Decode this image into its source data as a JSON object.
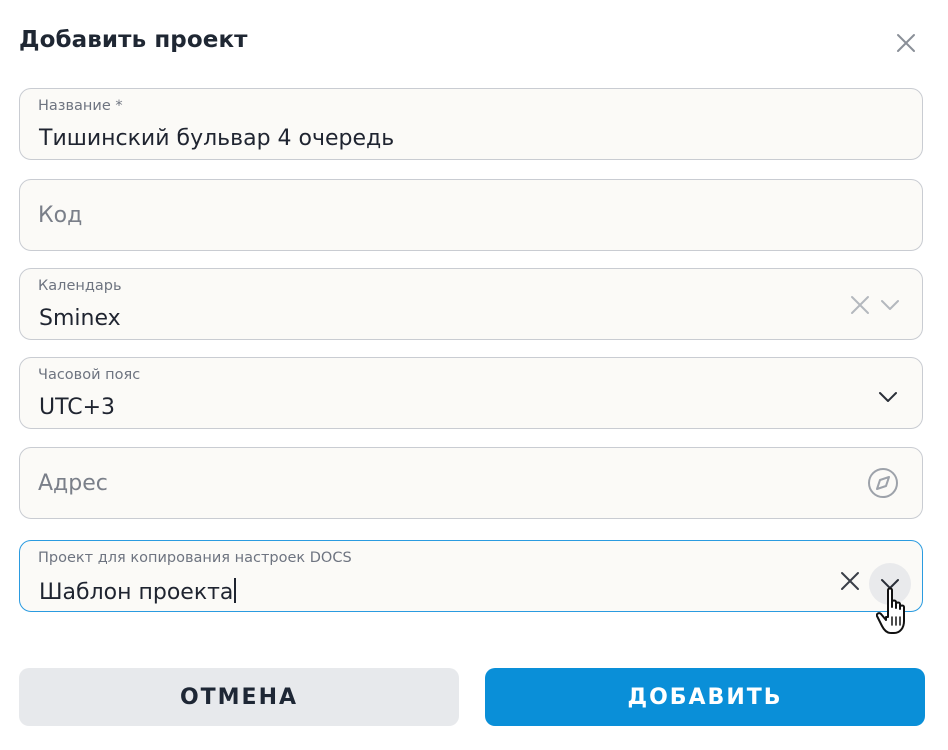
{
  "dialog": {
    "title": "Добавить проект"
  },
  "fields": {
    "name": {
      "label": "Название *",
      "value": "Тишинский бульвар 4 очередь"
    },
    "code": {
      "placeholder": "Код"
    },
    "calendar": {
      "label": "Календарь",
      "value": "Sminex"
    },
    "timezone": {
      "label": "Часовой пояс",
      "value": "UTC+3"
    },
    "address": {
      "placeholder": "Адрес"
    },
    "copy_project": {
      "label": "Проект для копирования настроек DOCS",
      "value": "Шаблон проекта"
    }
  },
  "buttons": {
    "cancel": "ОТМЕНА",
    "add": "ДОБАВИТЬ"
  },
  "icons": {
    "close": "close-icon",
    "clear": "clear-icon",
    "chevron": "chevron-down-icon",
    "location": "location-icon",
    "cursor": "hand-pointer-cursor"
  },
  "colors": {
    "accent": "#0a8fd8",
    "active_border": "#2a9be0",
    "field_border": "#c9ccd2",
    "field_bg": "#fbfaf7",
    "cancel_bg": "#e7e9ec",
    "title": "#1f2733"
  }
}
